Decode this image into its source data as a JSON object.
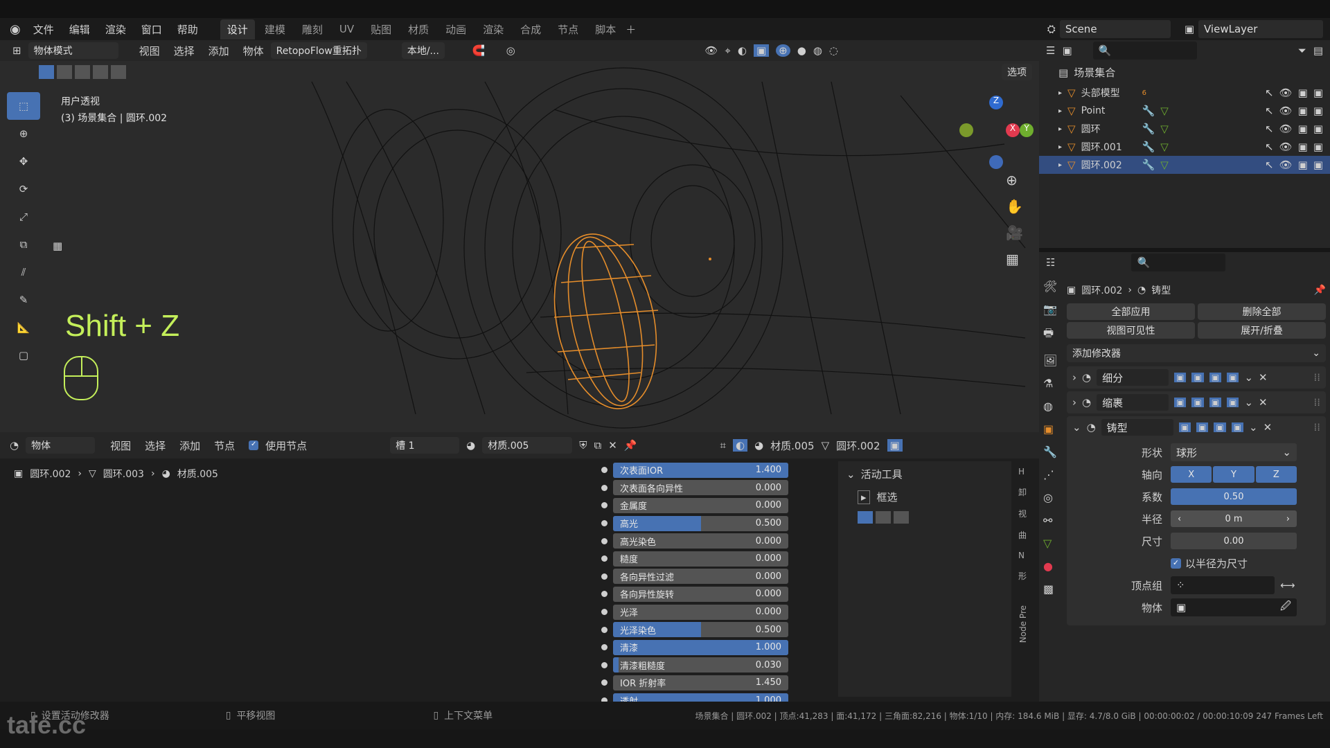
{
  "menu": [
    "文件",
    "编辑",
    "渲染",
    "窗口",
    "帮助"
  ],
  "workspaces": [
    "设计",
    "建模",
    "雕刻",
    "UV",
    "贴图",
    "材质",
    "动画",
    "渲染",
    "合成",
    "节点",
    "脚本"
  ],
  "scene": {
    "name": "Scene",
    "viewlayer": "ViewLayer"
  },
  "viewport": {
    "mode": "物体模式",
    "menus": [
      "视图",
      "选择",
      "添加",
      "物体"
    ],
    "addon": "RetopoFlow重拓扑",
    "transform": "本地/...",
    "options": "选项",
    "persp": "用户透视",
    "collection_label": "(3) 场景集合 | 圆环.002",
    "shortcut": "Shift + Z"
  },
  "outliner": {
    "root": "场景集合",
    "items": [
      {
        "name": "头部模型",
        "badge": "6"
      },
      {
        "name": "Point"
      },
      {
        "name": "圆环"
      },
      {
        "name": "圆环.001"
      },
      {
        "name": "圆环.002",
        "selected": true
      }
    ]
  },
  "properties": {
    "breadcrumb_object": "圆环.002",
    "breadcrumb_mod": "铸型",
    "apply_all": "全部应用",
    "delete_all": "删除全部",
    "viewport_vis": "视图可见性",
    "expand": "展开/折叠",
    "add_modifier": "添加修改器",
    "modifiers": [
      {
        "name": "细分"
      },
      {
        "name": "缩裹"
      },
      {
        "name": "铸型"
      }
    ],
    "cast": {
      "shape_label": "形状",
      "shape": "球形",
      "axis_label": "轴向",
      "axes": [
        "X",
        "Y",
        "Z"
      ],
      "factor_label": "系数",
      "factor": "0.50",
      "radius_label": "半径",
      "radius": "0 m",
      "size_label": "尺寸",
      "size": "0.00",
      "use_radius": "以半径为尺寸",
      "vgroup_label": "顶点组",
      "object_label": "物体"
    }
  },
  "node_editor": {
    "mode": "物体",
    "menus": [
      "视图",
      "选择",
      "添加",
      "节点"
    ],
    "use_nodes": "使用节点",
    "slot": "槽 1",
    "material": "材质.005",
    "mat_right": "材质.005",
    "obj_right": "圆环.002",
    "path": [
      "圆环.002",
      "圆环.003",
      "材质.005"
    ],
    "sliders": [
      {
        "label": "次表面IOR",
        "value": "1.400",
        "fill": 1
      },
      {
        "label": "次表面各向异性",
        "value": "0.000",
        "fill": 0
      },
      {
        "label": "金属度",
        "value": "0.000",
        "fill": 0
      },
      {
        "label": "高光",
        "value": "0.500",
        "fill": 0.5
      },
      {
        "label": "高光染色",
        "value": "0.000",
        "fill": 0
      },
      {
        "label": "糙度",
        "value": "0.000",
        "fill": 0
      },
      {
        "label": "各向异性过滤",
        "value": "0.000",
        "fill": 0
      },
      {
        "label": "各向异性旋转",
        "value": "0.000",
        "fill": 0
      },
      {
        "label": "光泽",
        "value": "0.000",
        "fill": 0
      },
      {
        "label": "光泽染色",
        "value": "0.500",
        "fill": 0.5
      },
      {
        "label": "清漆",
        "value": "1.000",
        "fill": 1
      },
      {
        "label": "清漆粗糙度",
        "value": "0.030",
        "fill": 0.03
      },
      {
        "label": "IOR 折射率",
        "value": "1.450",
        "fill": 0
      },
      {
        "label": "透射",
        "value": "1.000",
        "fill": 1
      }
    ],
    "active_tool": "活动工具",
    "tool_name": "框选",
    "side_tab": "Node Pre"
  },
  "status": {
    "left": "设置活动修改器",
    "mid": "平移视图",
    "right": "上下文菜单",
    "info": "场景集合 | 圆环.002 | 顶点:41,283 | 面:41,172 | 三角面:82,216 | 物体:1/10 | 内存: 184.6 MiB | 显存: 4.7/8.0 GiB | 00:00:00:02 / 00:00:10:09 247 Frames Left"
  },
  "watermark": "tafe.cc",
  "colors": {
    "accent": "#4772b3",
    "selected": "#334d80",
    "wire_select": "#e58d2b",
    "shortcut": "#c4ef5a"
  }
}
